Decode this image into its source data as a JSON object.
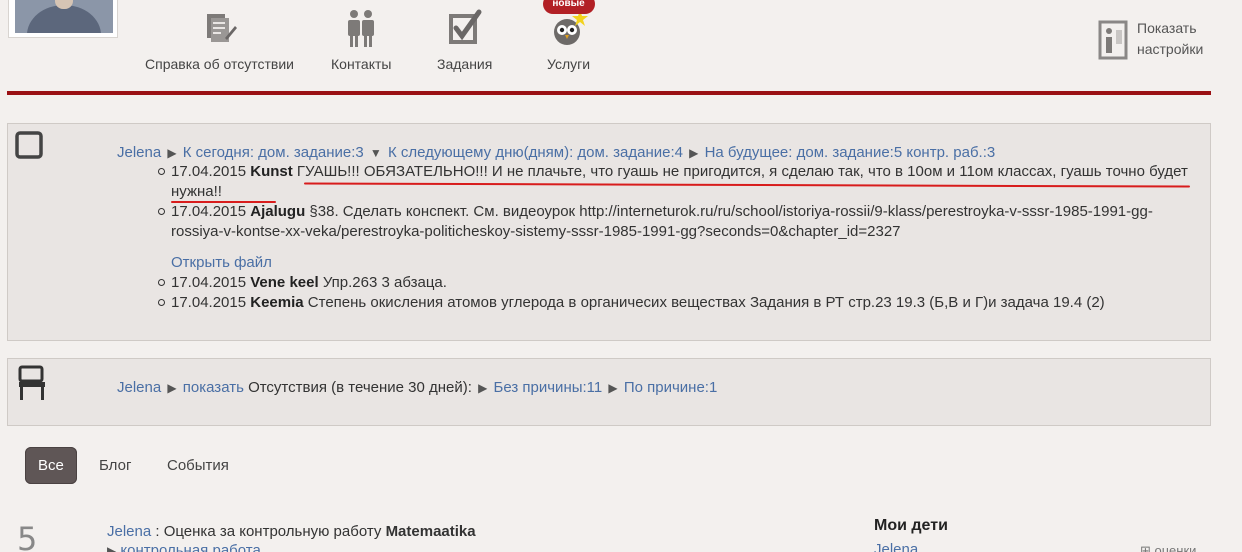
{
  "header": {
    "nav": [
      {
        "label": "Справка об отсутствии",
        "icon": "absence-certificate-icon"
      },
      {
        "label": "Контакты",
        "icon": "contacts-icon"
      },
      {
        "label": "Задания",
        "icon": "tasks-icon"
      },
      {
        "label": "Услуги",
        "icon": "services-owl-icon",
        "badge": "новые"
      }
    ],
    "settings_label_1": "Показать",
    "settings_label_2": "настройки"
  },
  "homework": {
    "student": "Jelena",
    "today": "К сегодня: дом. задание:3",
    "next_day": "К следующему дню(дням): дом. задание:4",
    "future": "На будущее: дом. задание:5 контр. раб.:3",
    "items": [
      {
        "date": "17.04.2015",
        "subject": "Kunst",
        "text": "ГУАШЬ!!! ОБЯЗАТЕЛЬНО!!! И не плачьте, что гуашь не пригодится, я сделаю так, что в 10ом и 11ом классах, гуашь точно будет нужна!!"
      },
      {
        "date": "17.04.2015",
        "subject": "Ajalugu",
        "text": "§38. Сделать конспект. См. видеоурок http://interneturok.ru/ru/school/istoriya-rossii/9-klass/perestroyka-v-sssr-1985-1991-gg-rossiya-v-kontse-xx-veka/perestroyka-politicheskoy-sistemy-sssr-1985-1991-gg?seconds=0&chapter_id=2327",
        "link": "Открыть файл"
      },
      {
        "date": "17.04.2015",
        "subject": "Vene keel",
        "text": "Упр.263 3 абзаца."
      },
      {
        "date": "17.04.2015",
        "subject": "Keemia",
        "text": "Степень окисления атомов углерода в органичесих веществах Задания в РТ стр.23 19.3 (Б,В и Г)и задача 19.4 (2)"
      }
    ]
  },
  "absences": {
    "student": "Jelena",
    "show": "показать",
    "period": "Отсутствия (в течение 30 дней):",
    "unexcused": "Без причины:11",
    "excused": "По причине:1"
  },
  "tabs": [
    {
      "label": "Все",
      "active": true
    },
    {
      "label": "Блог",
      "active": false
    },
    {
      "label": "События",
      "active": false
    }
  ],
  "feed": {
    "number": "5",
    "student": "Jelena",
    "text": " : Оценка за контрольную работу ",
    "subject": "Matemaatika",
    "sub": "контрольная работа"
  },
  "sidebar": {
    "title": "Мои дети",
    "child": "Jelena",
    "grades": "оценки"
  }
}
